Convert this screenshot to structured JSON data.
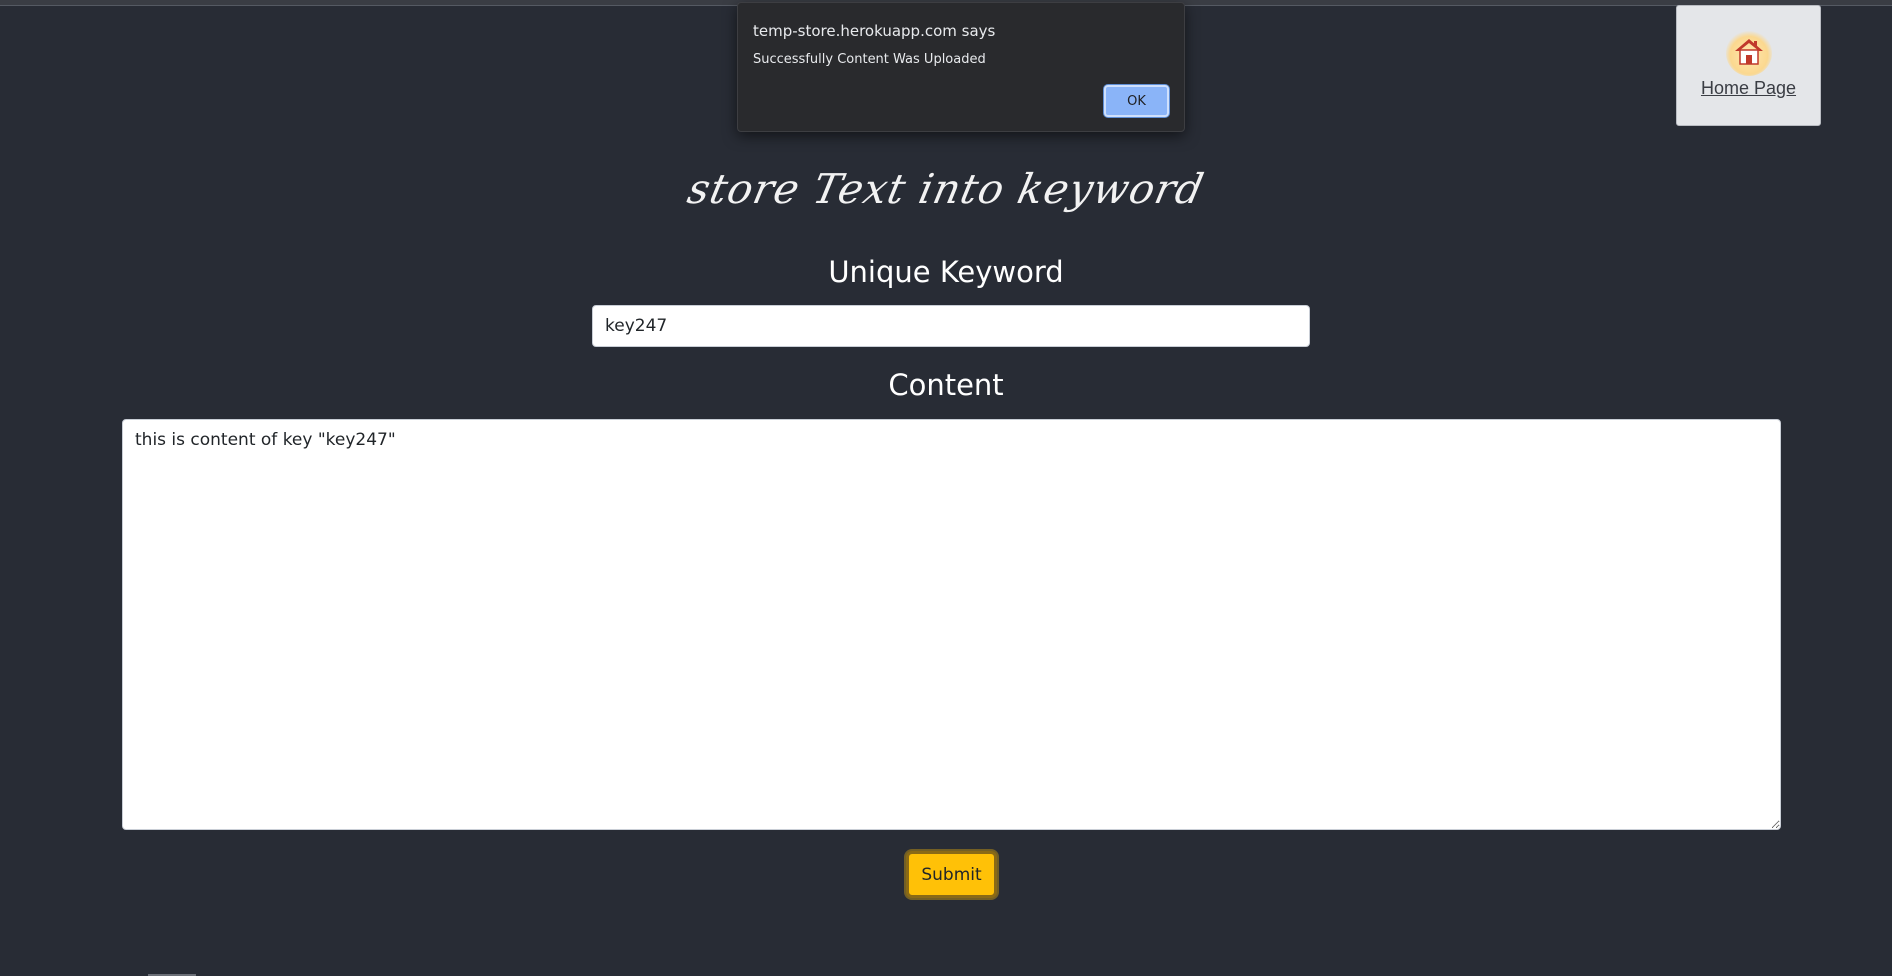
{
  "dialog": {
    "origin": "temp-store.herokuapp.com says",
    "message": "Successfully Content Was Uploaded",
    "ok_label": "OK"
  },
  "nav": {
    "home_label": "Home Page",
    "home_icon": "house-icon"
  },
  "main": {
    "title": "store Text into keyword",
    "keyword_label": "Unique Keyword",
    "keyword_value": "key247",
    "content_label": "Content",
    "content_value": "this is content of key \"key247\"",
    "submit_label": "Submit"
  },
  "colors": {
    "background": "#282c35",
    "submit": "#ffc107",
    "dialog_ok": "#8ab4f8"
  }
}
